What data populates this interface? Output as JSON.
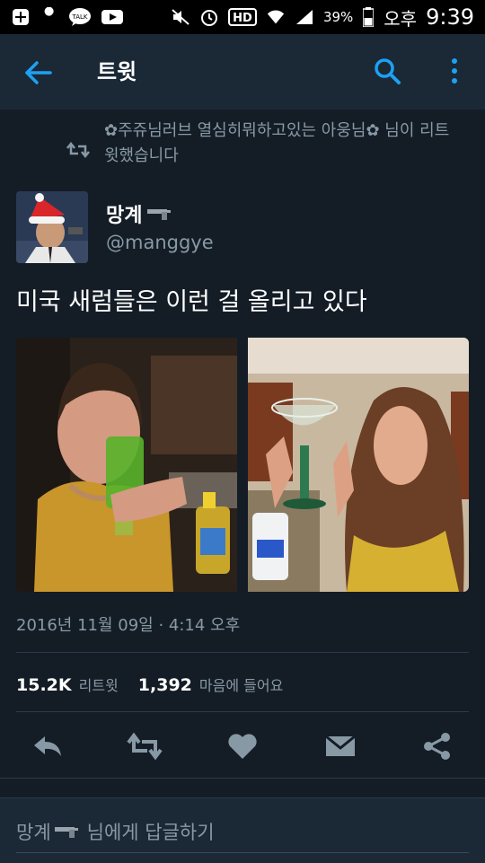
{
  "status_bar": {
    "battery": "39%",
    "ampm": "오후",
    "time": "9:39",
    "talk_label": "TALK",
    "hd_label": "HD"
  },
  "app_bar": {
    "title": "트윗"
  },
  "retweet_context": {
    "text": "✿주쥬님러브 열심히뭐하고있는 아웅님✿ 님이 리트윗했습니다"
  },
  "tweet": {
    "display_name": "망계",
    "username": "@manggye",
    "text": "미국 새럼들은 이런 걸 올리고 있다",
    "timestamp": "2016년 11월 09일 · 4:14 오후"
  },
  "stats": {
    "retweets_count": "15.2K",
    "retweets_label": "리트윗",
    "likes_count": "1,392",
    "likes_label": "마음에 들어요"
  },
  "reply": {
    "name": "망계",
    "suffix": "님에게 답글하기"
  },
  "colors": {
    "background": "#141d26",
    "bar": "#1b2836",
    "accent": "#1da1f2",
    "secondary_text": "#8899a6"
  }
}
